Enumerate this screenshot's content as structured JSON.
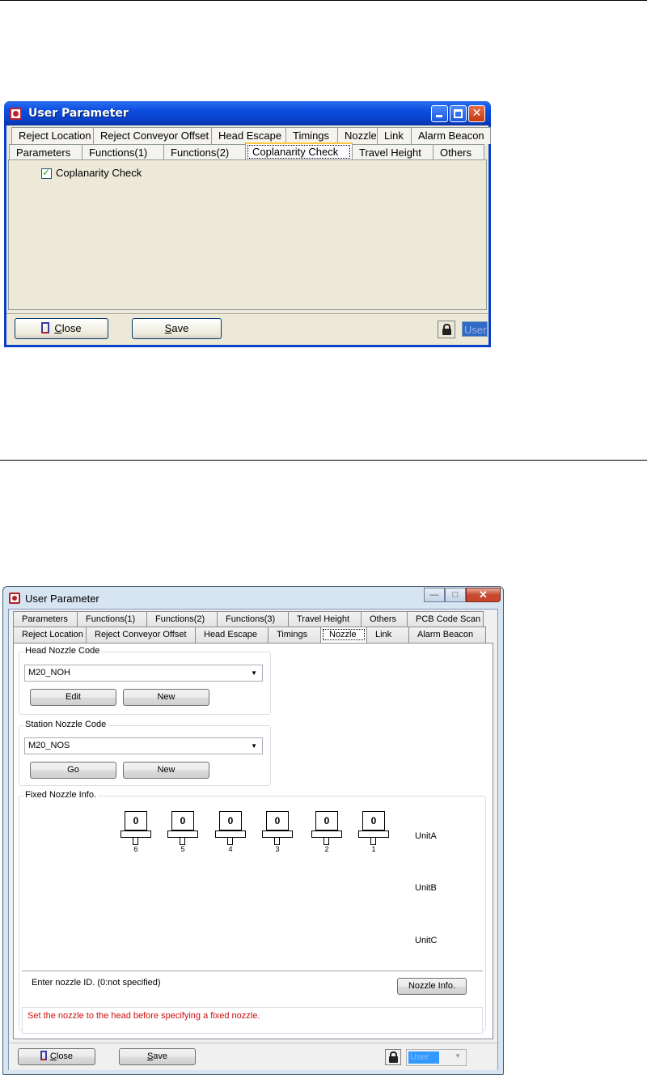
{
  "window1": {
    "title": "User Parameter",
    "tabs_row1": [
      "Reject Location",
      "Reject Conveyor Offset",
      "Head Escape",
      "Timings",
      "Nozzle",
      "Link",
      "Alarm Beacon"
    ],
    "tabs_row2": [
      "Parameters",
      "Functions(1)",
      "Functions(2)",
      "Coplanarity Check",
      "Travel Height",
      "Others"
    ],
    "active_tab": "Coplanarity Check",
    "checkbox_label": "Coplanarity Check",
    "checkbox_checked": true,
    "close_accel": "C",
    "close_rest": "lose",
    "save_accel": "S",
    "save_rest": "ave",
    "user_value": "User"
  },
  "window2": {
    "title": "User Parameter",
    "tabs_row1": [
      "Parameters",
      "Functions(1)",
      "Functions(2)",
      "Functions(3)",
      "Travel Height",
      "Others",
      "PCB Code Scan"
    ],
    "tabs_row2": [
      "Reject Location",
      "Reject Conveyor Offset",
      "Head Escape",
      "Timings",
      "Nozzle",
      "Link",
      "Alarm Beacon"
    ],
    "active_tab": "Nozzle",
    "head_nozzle": {
      "label": "Head Nozzle Code",
      "value": "M20_NOH",
      "edit_label": "Edit",
      "new_label": "New"
    },
    "station_nozzle": {
      "label": "Station Nozzle Code",
      "value": "M20_NOS",
      "go_label": "Go",
      "new_label": "New"
    },
    "fixed_nozzle": {
      "label": "Fixed Nozzle Info.",
      "nozzles": [
        {
          "value": "0",
          "number": "6"
        },
        {
          "value": "0",
          "number": "5"
        },
        {
          "value": "0",
          "number": "4"
        },
        {
          "value": "0",
          "number": "3"
        },
        {
          "value": "0",
          "number": "2"
        },
        {
          "value": "0",
          "number": "1"
        }
      ],
      "units": [
        "UnitA",
        "UnitB",
        "UnitC"
      ]
    },
    "hint": "Enter nozzle ID. (0:not specified)",
    "nozzle_info_label": "Nozzle Info.",
    "message": "Set the nozzle to the head before specifying a fixed nozzle.",
    "close_accel": "C",
    "close_rest": "lose",
    "save_accel": "S",
    "save_rest": "ave",
    "user_value": "User"
  }
}
